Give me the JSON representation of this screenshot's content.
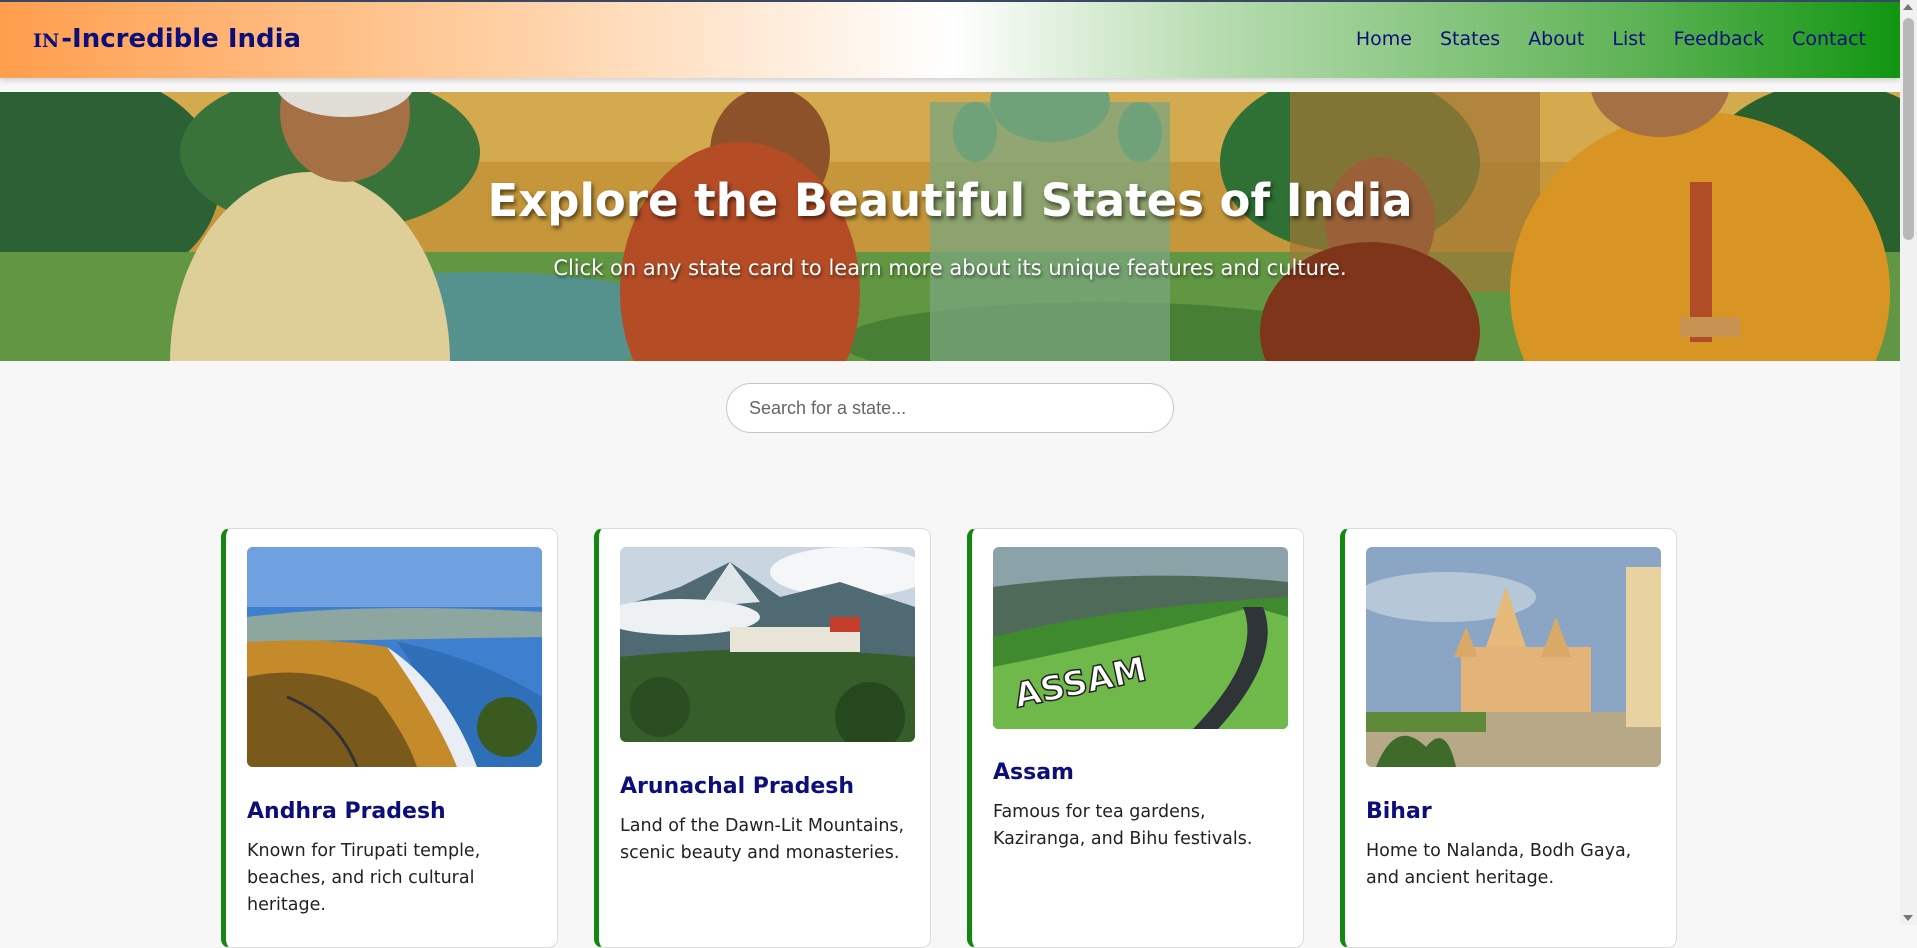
{
  "brand": {
    "flag_code": "IN",
    "name": "-Incredible India"
  },
  "nav": {
    "items": [
      "Home",
      "States",
      "About",
      "List",
      "Feedback",
      "Contact"
    ]
  },
  "hero": {
    "title": "Explore the Beautiful States of India",
    "subtitle": "Click on any state card to learn more about its unique features and culture."
  },
  "search": {
    "placeholder": "Search for a state...",
    "value": ""
  },
  "cards": [
    {
      "name": "Andhra Pradesh",
      "description": "Known for Tirupati temple, beaches, and rich cultural heritage."
    },
    {
      "name": "Arunachal Pradesh",
      "description": "Land of the Dawn-Lit Mountains, scenic beauty and monasteries."
    },
    {
      "name": "Assam",
      "description": "Famous for tea gardens, Kaziranga, and Bihu festivals.",
      "image_text": "ASSAM"
    },
    {
      "name": "Bihar",
      "description": "Home to Nalanda, Bodh Gaya, and ancient heritage."
    }
  ],
  "colors": {
    "brand": "#0c0f7a",
    "card_accent": "#128812",
    "saffron": "#ff9e4d",
    "green": "#119611"
  },
  "icons": [
    "scroll-up-arrow-icon",
    "scroll-down-arrow-icon"
  ]
}
